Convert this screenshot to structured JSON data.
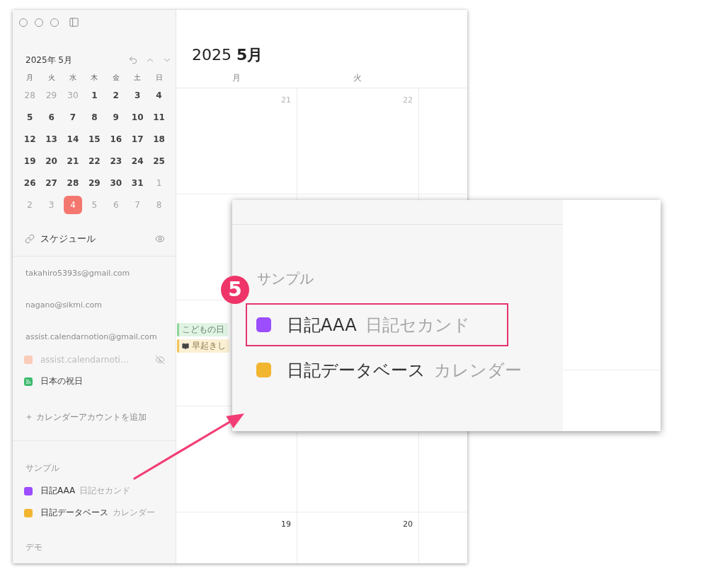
{
  "mini_calendar": {
    "title": "2025年 5月",
    "weekdays": [
      "月",
      "火",
      "水",
      "木",
      "金",
      "土",
      "日"
    ],
    "weeks": [
      {
        "days": [
          {
            "label": "28",
            "muted": true,
            "today": false
          },
          {
            "label": "29",
            "muted": true,
            "today": false
          },
          {
            "label": "30",
            "muted": true,
            "today": false
          },
          {
            "label": "1",
            "muted": false,
            "today": false
          },
          {
            "label": "2",
            "muted": false,
            "today": false
          },
          {
            "label": "3",
            "muted": false,
            "today": false
          },
          {
            "label": "4",
            "muted": false,
            "today": false
          }
        ]
      },
      {
        "days": [
          {
            "label": "5",
            "muted": false,
            "today": false
          },
          {
            "label": "6",
            "muted": false,
            "today": false
          },
          {
            "label": "7",
            "muted": false,
            "today": false
          },
          {
            "label": "8",
            "muted": false,
            "today": false
          },
          {
            "label": "9",
            "muted": false,
            "today": false
          },
          {
            "label": "10",
            "muted": false,
            "today": false
          },
          {
            "label": "11",
            "muted": false,
            "today": false
          }
        ]
      },
      {
        "days": [
          {
            "label": "12",
            "muted": false,
            "today": false
          },
          {
            "label": "13",
            "muted": false,
            "today": false
          },
          {
            "label": "14",
            "muted": false,
            "today": false
          },
          {
            "label": "15",
            "muted": false,
            "today": false
          },
          {
            "label": "16",
            "muted": false,
            "today": false
          },
          {
            "label": "17",
            "muted": false,
            "today": false
          },
          {
            "label": "18",
            "muted": false,
            "today": false
          }
        ]
      },
      {
        "days": [
          {
            "label": "19",
            "muted": false,
            "today": false
          },
          {
            "label": "20",
            "muted": false,
            "today": false
          },
          {
            "label": "21",
            "muted": false,
            "today": false
          },
          {
            "label": "22",
            "muted": false,
            "today": false
          },
          {
            "label": "23",
            "muted": false,
            "today": false
          },
          {
            "label": "24",
            "muted": false,
            "today": false
          },
          {
            "label": "25",
            "muted": false,
            "today": false
          }
        ]
      },
      {
        "days": [
          {
            "label": "26",
            "muted": false,
            "today": false
          },
          {
            "label": "27",
            "muted": false,
            "today": false
          },
          {
            "label": "28",
            "muted": false,
            "today": false
          },
          {
            "label": "29",
            "muted": false,
            "today": false
          },
          {
            "label": "30",
            "muted": false,
            "today": false
          },
          {
            "label": "31",
            "muted": false,
            "today": false
          },
          {
            "label": "1",
            "muted": true,
            "today": false
          }
        ]
      },
      {
        "days": [
          {
            "label": "2",
            "muted": true,
            "today": false
          },
          {
            "label": "3",
            "muted": true,
            "today": false
          },
          {
            "label": "4",
            "muted": true,
            "today": true
          },
          {
            "label": "5",
            "muted": true,
            "today": false
          },
          {
            "label": "6",
            "muted": true,
            "today": false
          },
          {
            "label": "7",
            "muted": true,
            "today": false
          },
          {
            "label": "8",
            "muted": true,
            "today": false
          }
        ]
      }
    ]
  },
  "sidebar": {
    "link": {
      "label": "スケジュール"
    },
    "accounts": [
      {
        "email": "takahiro5393s@gmail.com"
      },
      {
        "email": "nagano@sikmi.com"
      },
      {
        "email": "assist.calendarnotion@gmail.com",
        "calendars": [
          {
            "kind": "color",
            "name": "assist.calendarnoti…",
            "color": "#f9cbb9",
            "hidden": true
          },
          {
            "kind": "feed",
            "name": "日本の祝日",
            "color": "#3dbb6c",
            "hidden": false
          }
        ]
      }
    ],
    "add_account": "カレンダーアカウントを追加",
    "groups": [
      {
        "title": "サンプル",
        "calendars": [
          {
            "name": "日記AAA",
            "source": "日記セカンド",
            "color": "#9b4dff"
          },
          {
            "name": "日記データベース",
            "source": "カレンダー",
            "color": "#f2b530"
          }
        ]
      },
      {
        "title": "デモ"
      }
    ]
  },
  "main": {
    "title": "2025 **5月**",
    "weekdays": [
      "月",
      "火"
    ],
    "weeks": [
      {
        "kind": "filled",
        "cells": [
          {
            "date": "21",
            "muted": true
          },
          {
            "date": "22",
            "muted": true
          }
        ]
      },
      {
        "kind": "blank"
      },
      {
        "kind": "filled",
        "cells": [
          {
            "events": [
              {
                "kind": "holiday",
                "title": "こどもの日",
                "color": "#8ed69a"
              },
              {
                "kind": "note",
                "title": "早起きし",
                "color": "#f1c65c"
              }
            ]
          }
        ]
      },
      {
        "kind": "blank"
      },
      {
        "kind": "filled",
        "cells": [
          {
            "date": "19",
            "muted": false
          },
          {
            "date": "20",
            "muted": false
          }
        ]
      }
    ]
  },
  "callout": {
    "step": "5",
    "group_title": "サンプル",
    "calendars": [
      {
        "name": "日記AAA",
        "source": "日記セカンド",
        "color": "#9b4dff",
        "highlighted": true
      },
      {
        "name": "日記データベース",
        "source": "カレンダー",
        "color": "#f2b530",
        "highlighted": false
      }
    ]
  }
}
